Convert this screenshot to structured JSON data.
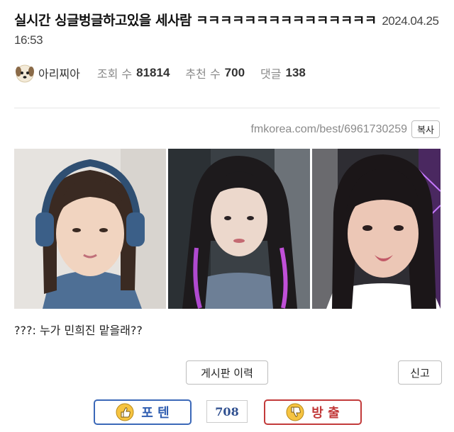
{
  "post": {
    "title": "실시간 싱글벙글하고있을 세사람 ㅋㅋㅋㅋㅋㅋㅋㅋㅋㅋㅋㅋㅋㅋㅋ",
    "date": "2024.04.25 16:53",
    "author": "아리찌아",
    "views_label": "조회 수",
    "views": "81814",
    "likes_label": "추천 수",
    "likes": "700",
    "comments_label": "댓글",
    "comments": "138",
    "url": "fmkorea.com/best/6961730259",
    "copy_label": "복사",
    "caption": "???: 누가 민희진 맡을래??",
    "history_label": "게시판 이력",
    "report_label": "신고",
    "upvote_label": "포 텐",
    "vote_count": "708",
    "downvote_label": "방 출"
  },
  "colors": {
    "upvote": "#2f5db0",
    "downvote": "#c23a3a"
  }
}
